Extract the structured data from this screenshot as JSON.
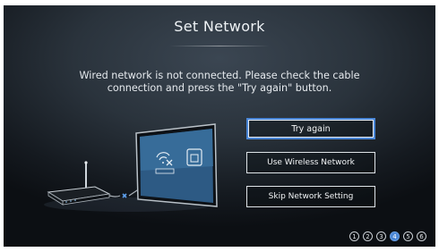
{
  "dialog": {
    "title": "Set Network",
    "message_line1": "Wired network is not connected. Please check the cable",
    "message_line2": "connection and press the \"Try again\" button."
  },
  "buttons": {
    "try_again": "Try again",
    "wireless": "Use Wireless Network",
    "skip": "Skip Network Setting"
  },
  "steps": {
    "labels": [
      "1",
      "2",
      "3",
      "4",
      "5",
      "6"
    ],
    "current": 4
  },
  "colors": {
    "accent": "#4a86d6",
    "background": "#2a333c"
  },
  "icons": {
    "router": "router-icon",
    "disconnected": "cable-disconnected-icon",
    "tv": "tv-icon",
    "wifi_error": "wifi-error-icon"
  }
}
